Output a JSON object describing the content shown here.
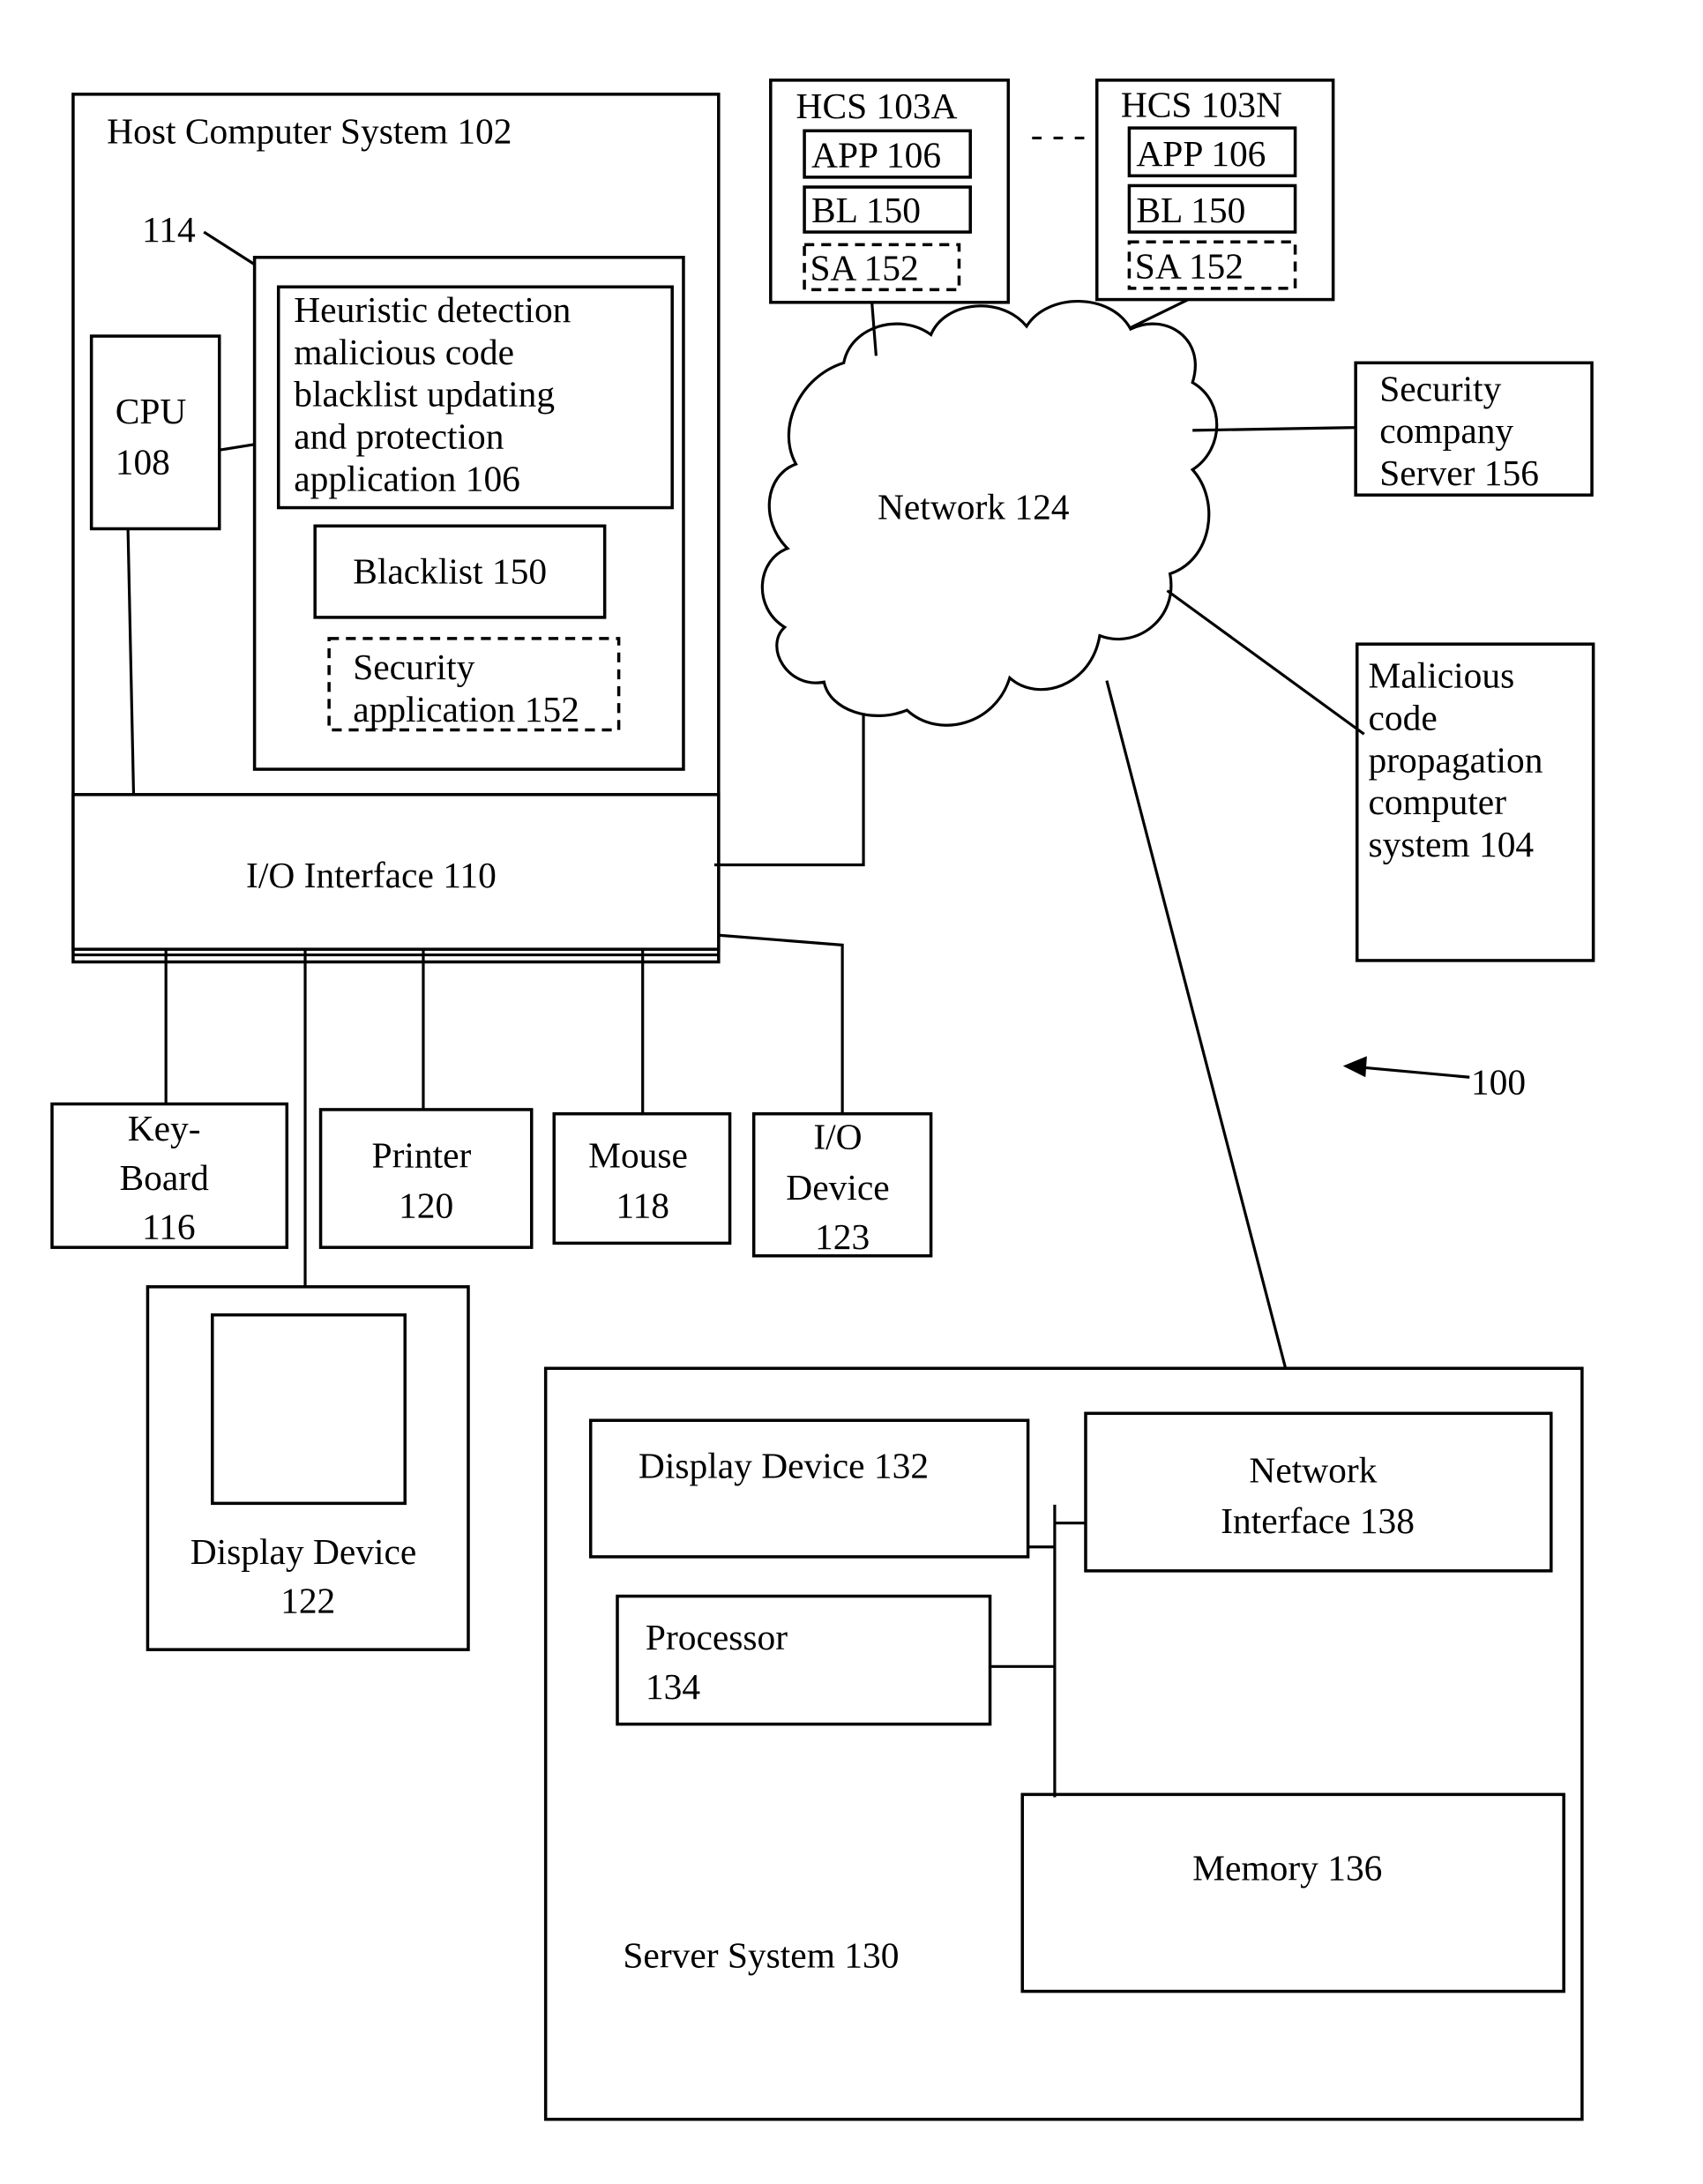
{
  "figure_ref": "100",
  "host": {
    "title": "Host Computer System 102",
    "memory_ref": "114",
    "app_lines": [
      "Heuristic detection",
      "malicious code",
      "blacklist updating",
      "and protection",
      "application 106"
    ],
    "blacklist": "Blacklist 150",
    "security_app_lines": [
      "Security",
      "application 152"
    ],
    "cpu_lines": [
      "CPU",
      "108"
    ],
    "io_interface": "I/O Interface 110"
  },
  "peripherals": {
    "keyboard_lines": [
      "Key-",
      "Board",
      "116"
    ],
    "printer_lines": [
      "Printer",
      "120"
    ],
    "mouse_lines": [
      "Mouse",
      "118"
    ],
    "io_device_lines": [
      "I/O",
      "Device",
      "123"
    ],
    "display_lines": [
      "Display Device",
      "122"
    ]
  },
  "hcs": [
    {
      "title": "HCS 103A",
      "app": "APP 106",
      "bl": "BL 150",
      "sa": "SA 152"
    },
    {
      "title": "HCS 103N",
      "app": "APP 106",
      "bl": "BL 150",
      "sa": "SA 152"
    }
  ],
  "hcs_ellipsis": "- - -",
  "network": "Network 124",
  "security_server_lines": [
    "Security",
    "company",
    "Server 156"
  ],
  "malicious_lines": [
    "Malicious",
    "code",
    "propagation",
    "computer",
    "system 104"
  ],
  "server": {
    "title": "Server System 130",
    "display": "Display Device 132",
    "network_interface_lines": [
      "Network",
      "Interface 138"
    ],
    "processor_lines": [
      "Processor",
      "134"
    ],
    "memory": "Memory 136"
  }
}
